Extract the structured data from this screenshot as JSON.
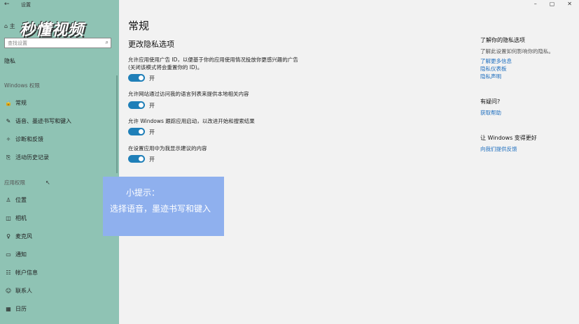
{
  "window": {
    "title": "设置",
    "back": "←",
    "minimize": "–",
    "maximize": "▢",
    "close": "✕"
  },
  "watermark": "秒懂视频",
  "sidebar": {
    "home_label": "主",
    "search_placeholder": "查找设置",
    "section_title": "隐私",
    "group_windows": "Windows 权限",
    "windows_items": [
      {
        "label": "常规",
        "icon": "lock-icon",
        "glyph": "🔒"
      },
      {
        "label": "语音、墨迹书写和键入",
        "icon": "pen-icon",
        "glyph": "✎"
      },
      {
        "label": "诊断和反馈",
        "icon": "feedback-icon",
        "glyph": "✧"
      },
      {
        "label": "活动历史记录",
        "icon": "history-icon",
        "glyph": "⎘"
      }
    ],
    "group_apps": "应用权限",
    "app_items": [
      {
        "label": "位置",
        "icon": "location-icon",
        "glyph": "♙"
      },
      {
        "label": "相机",
        "icon": "camera-icon",
        "glyph": "◫"
      },
      {
        "label": "麦克风",
        "icon": "microphone-icon",
        "glyph": "♀"
      },
      {
        "label": "通知",
        "icon": "notification-icon",
        "glyph": "▭"
      },
      {
        "label": "帐户信息",
        "icon": "account-info-icon",
        "glyph": "☷"
      },
      {
        "label": "联系人",
        "icon": "contacts-icon",
        "glyph": "☺"
      },
      {
        "label": "日历",
        "icon": "calendar-icon",
        "glyph": "▦"
      }
    ]
  },
  "main": {
    "title": "常规",
    "subtitle": "更改隐私选项",
    "options": [
      {
        "text": "允许应用使用广告 ID，以便基于你的应用使用情况投放你更感兴趣的广告(关闭该模式将会重置你的 ID)。",
        "state": "开"
      },
      {
        "text": "允许网站通过访问我的语言列表来提供本地相关内容",
        "state": "开"
      },
      {
        "text": "允许 Windows 跟踪应用启动，以改进开始和搜索结果",
        "state": "开"
      },
      {
        "text": "在设置应用中为我显示建议的内容",
        "state": "开"
      }
    ]
  },
  "right": {
    "know_title": "了解你的隐私选项",
    "know_text": "了解此设置如何影响你的隐私。",
    "links": [
      "了解更多信息",
      "隐私仪表板",
      "隐私声明"
    ],
    "question_title": "有疑问?",
    "help_link": "获取帮助",
    "improve_title": "让 Windows 变得更好",
    "feedback_link": "向我们提供反馈"
  },
  "tip": {
    "title": "小提示：",
    "body": "选择语音，墨迹书写和键入"
  },
  "colors": {
    "sidebar": "#8fc3b4",
    "toggle_on": "#1f7fb8",
    "tip_bg": "#8fb0ee",
    "link": "#1f6fbf"
  }
}
